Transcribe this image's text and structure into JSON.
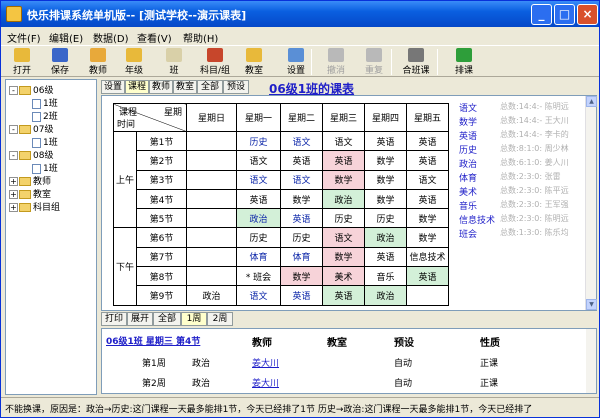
{
  "window": {
    "title": "快乐排课系统单机版-- [测试学校--演示课表]"
  },
  "menu": [
    "文件(F)",
    "编辑(E)",
    "数据(D)",
    "查看(V)",
    "帮助(H)"
  ],
  "toolbar": [
    {
      "label": "打开",
      "icon": "open-folder-icon",
      "color": "#e8b93a",
      "enabled": true
    },
    {
      "label": "保存",
      "icon": "save-disk-icon",
      "color": "#3a66c9",
      "enabled": true
    },
    {
      "label": "教师",
      "icon": "teacher-icon",
      "color": "#e8a93a",
      "enabled": true
    },
    {
      "label": "年级",
      "icon": "grade-icon",
      "color": "#e8b93a",
      "enabled": true
    },
    {
      "label": "班",
      "icon": "class-icon",
      "color": "#d9d0a8",
      "enabled": true
    },
    {
      "label": "科目/组",
      "icon": "subject-group-icon",
      "color": "#c7462b",
      "enabled": true
    },
    {
      "label": "教室",
      "icon": "classroom-icon",
      "color": "#e8b93a",
      "enabled": true
    },
    {
      "label": "设置",
      "icon": "settings-icon",
      "color": "#5a8fd6",
      "enabled": true
    },
    {
      "label": "撤消",
      "icon": "undo-icon",
      "color": "#b9b9b9",
      "enabled": false
    },
    {
      "label": "重复",
      "icon": "redo-icon",
      "color": "#b9b9b9",
      "enabled": false
    },
    {
      "label": "合班课",
      "icon": "merge-class-icon",
      "color": "#777777",
      "enabled": true
    },
    {
      "label": "排课",
      "icon": "schedule-icon",
      "color": "#2e9e3a",
      "enabled": true
    }
  ],
  "tree": {
    "grade06": "06级",
    "class06_1": "1班",
    "class06_2": "2班",
    "grade07": "07级",
    "class07_1": "1班",
    "grade08": "08级",
    "class08_1": "1班",
    "teachers": "教师",
    "classrooms": "教室",
    "subject_groups": "科目组"
  },
  "top_tabs": [
    "设置",
    "课程",
    "教师",
    "教室",
    "全部",
    "预设"
  ],
  "schedule_title": "06级1班的课表",
  "grid": {
    "corner_top": "星期",
    "corner_top2": "课程",
    "corner_bottom": "时间",
    "days": [
      "星期日",
      "星期一",
      "星期二",
      "星期三",
      "星期四",
      "星期五"
    ],
    "morning": "上午",
    "afternoon": "下午",
    "periods": [
      "第1节",
      "第2节",
      "第3节",
      "第4节",
      "第5节",
      "第6节",
      "第7节",
      "第8节",
      "第9节"
    ],
    "cells": [
      [
        "",
        "历史",
        "语文",
        "语文",
        "英语",
        "英语"
      ],
      [
        "",
        "语文",
        "英语",
        "英语",
        "数学",
        "英语"
      ],
      [
        "",
        "语文",
        "语文",
        "数学",
        "数学",
        "语文"
      ],
      [
        "",
        "英语",
        "数学",
        "政治",
        "数学",
        "英语"
      ],
      [
        "",
        "政治",
        "英语",
        "历史",
        "历史",
        "数学"
      ],
      [
        "",
        "历史",
        "历史",
        "语文",
        "政治",
        "数学"
      ],
      [
        "",
        "体育",
        "体育",
        "数学",
        "英语",
        "信息技术"
      ],
      [
        "",
        "* 班会",
        "数学",
        "美术",
        "音乐",
        "英语"
      ],
      [
        "政治",
        "语文",
        "英语",
        "英语",
        "政治",
        ""
      ]
    ],
    "cell_bg": [
      [
        "",
        "",
        "",
        "",
        "",
        ""
      ],
      [
        "",
        "",
        "",
        "r",
        "",
        ""
      ],
      [
        "",
        "",
        "",
        "r",
        "",
        ""
      ],
      [
        "",
        "",
        "",
        "g",
        "",
        ""
      ],
      [
        "",
        "g",
        "",
        "",
        "",
        ""
      ],
      [
        "",
        "",
        "",
        "r",
        "g",
        ""
      ],
      [
        "",
        "",
        "",
        "r",
        "",
        ""
      ],
      [
        "",
        "",
        "r",
        "r",
        "",
        "g"
      ],
      [
        "",
        "",
        "",
        "g",
        "g",
        ""
      ]
    ]
  },
  "right_panel": {
    "subjects": [
      "语文",
      "数学",
      "英语",
      "历史",
      "政治",
      "体育",
      "美术",
      "音乐",
      "信息技术",
      "班会"
    ],
    "lines": [
      "总数:14:4:- 陈明远",
      "总数:14:4:- 王大川",
      "总数:14:4:- 李卡的",
      "总数:8:1:0: 周少林",
      "总数:6:1:0: 姜人川",
      "总数:2:3:0: 张雷",
      "总数:2:3:0: 陈平远",
      "总数:2:3:0: 王军强",
      "总数:2:3:0: 陈明远",
      "总数:1:3:0: 陈乐均"
    ]
  },
  "bottom_tabs": [
    "打印",
    "展开",
    "全部",
    "1周",
    "2周"
  ],
  "list": {
    "headers": [
      "06级1班 星期三 第4节",
      "教师",
      "教室",
      "预设",
      "性质"
    ],
    "rows": [
      {
        "week": "第1周",
        "subject": "政治",
        "teacher": "姜大川",
        "preset": "自动",
        "nature": "正课"
      },
      {
        "week": "第2周",
        "subject": "政治",
        "teacher": "姜大川",
        "preset": "自动",
        "nature": "正课"
      }
    ]
  },
  "status": "不能换课，原因是：政治→历史:这门课程一天最多能排1节，今天已经排了1节   历史→政治:这门课程一天最多能排1节，今天已经排了"
}
